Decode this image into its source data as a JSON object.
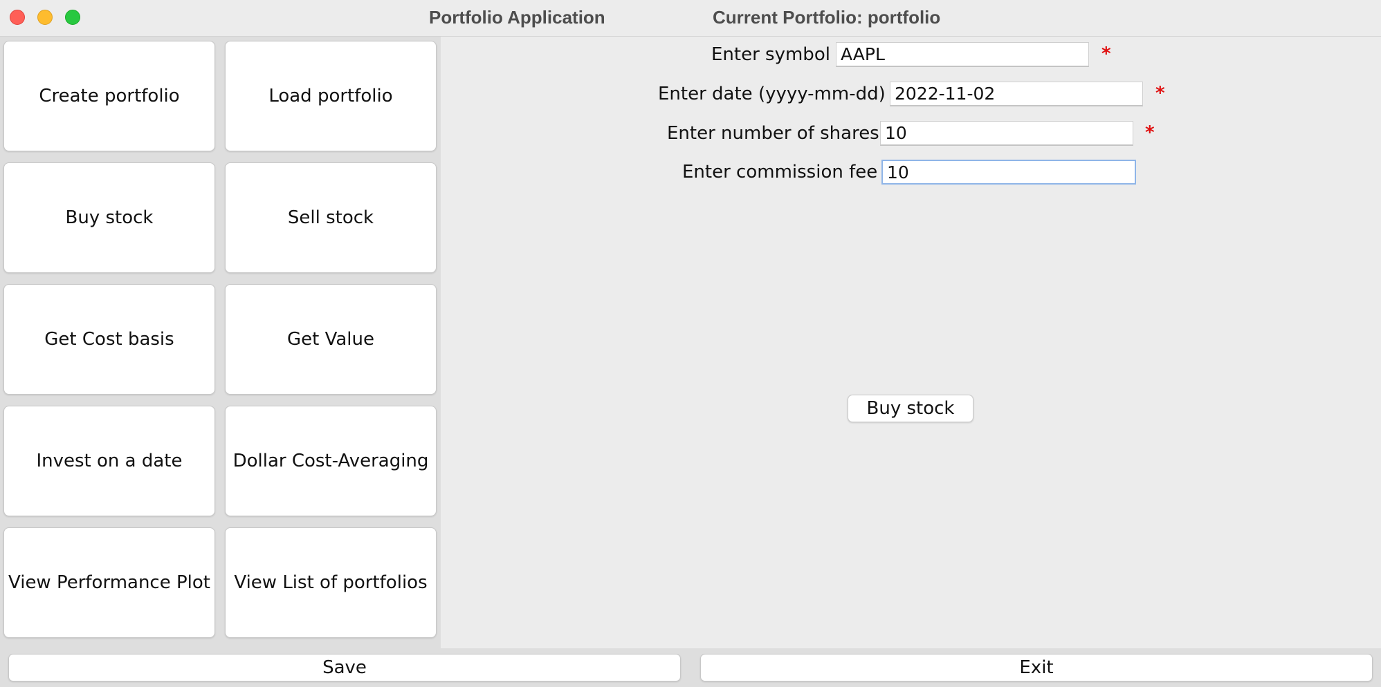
{
  "window": {
    "app_title": "Portfolio Application",
    "current_portfolio": "Current Portfolio: portfolio",
    "traffic_lights": {
      "close_color": "#ff5f57",
      "minimize_color": "#febc2e",
      "maximize_color": "#28c840"
    }
  },
  "sidebar": {
    "buttons": [
      {
        "label": "Create portfolio"
      },
      {
        "label": "Load portfolio"
      },
      {
        "label": "Buy stock"
      },
      {
        "label": "Sell stock"
      },
      {
        "label": "Get Cost basis"
      },
      {
        "label": "Get Value"
      },
      {
        "label": "Invest on a date"
      },
      {
        "label": "Dollar Cost-Averaging"
      },
      {
        "label": "View Performance Plot"
      },
      {
        "label": "View List of portfolios"
      }
    ]
  },
  "form": {
    "fields": [
      {
        "label": "Enter symbol",
        "value": "AAPL",
        "required": "*"
      },
      {
        "label": "Enter date (yyyy-mm-dd)",
        "value": "2022-11-02",
        "required": "*"
      },
      {
        "label": "Enter number of shares",
        "value": "10",
        "required": "*"
      },
      {
        "label": "Enter commission fee",
        "value": "10"
      }
    ],
    "submit_label": "Buy stock",
    "required_color": "#e01010",
    "focus_color": "#8fb5e8"
  },
  "footer": {
    "save_label": "Save",
    "exit_label": "Exit"
  }
}
